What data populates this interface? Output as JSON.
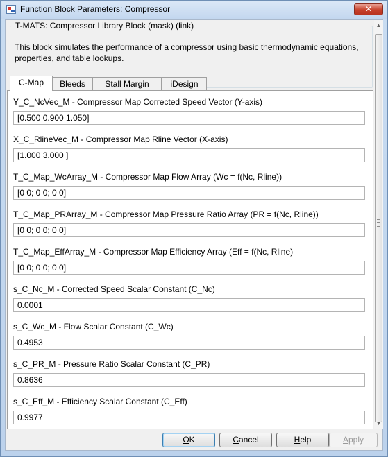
{
  "window": {
    "title": "Function Block Parameters: Compressor",
    "close_symbol": "✕"
  },
  "description": {
    "legend": "T-MATS: Compressor Library Block (mask) (link)",
    "text": "This block simulates the performance of a compressor using basic thermodynamic equations, properties, and table lookups."
  },
  "tabs": [
    {
      "label": "C-Map",
      "active": true
    },
    {
      "label": "Bleeds",
      "active": false
    },
    {
      "label": "Stall Margin",
      "active": false
    },
    {
      "label": "iDesign",
      "active": false
    }
  ],
  "params": [
    {
      "label": "Y_C_NcVec_M - Compressor Map Corrected Speed Vector (Y-axis)",
      "value": "[0.500  0.900  1.050]"
    },
    {
      "label": "X_C_RlineVec_M - Compressor Map Rline Vector (X-axis)",
      "value": "[1.000 3.000 ]"
    },
    {
      "label": "T_C_Map_WcArray_M - Compressor Map Flow Array (Wc = f(Nc, Rline))",
      "value": "[0 0; 0 0; 0 0]"
    },
    {
      "label": "T_C_Map_PRArray_M - Compressor Map Pressure Ratio Array (PR = f(Nc, Rline))",
      "value": "[0 0; 0 0; 0 0]"
    },
    {
      "label": "T_C_Map_EffArray_M - Compressor Map Efficiency Array (Eff = f(Nc, Rline)",
      "value": "[0 0; 0 0; 0 0]"
    },
    {
      "label": "s_C_Nc_M - Corrected Speed Scalar Constant (C_Nc)",
      "value": "0.0001"
    },
    {
      "label": "s_C_Wc_M - Flow Scalar Constant (C_Wc)",
      "value": "0.4953"
    },
    {
      "label": "s_C_PR_M - Pressure Ratio Scalar Constant (C_PR)",
      "value": "0.8636"
    },
    {
      "label": "s_C_Eff_M - Efficiency Scalar Constant (C_Eff)",
      "value": "0.9977"
    }
  ],
  "buttons": {
    "ok": {
      "mnemonic": "O",
      "rest": "K"
    },
    "cancel": {
      "mnemonic": "C",
      "rest": "ancel"
    },
    "help": {
      "mnemonic": "H",
      "rest": "elp"
    },
    "apply": {
      "mnemonic": "A",
      "rest": "pply",
      "disabled": true
    }
  },
  "scrollbar": {
    "up_symbol": "▲",
    "down_symbol": "▼"
  }
}
